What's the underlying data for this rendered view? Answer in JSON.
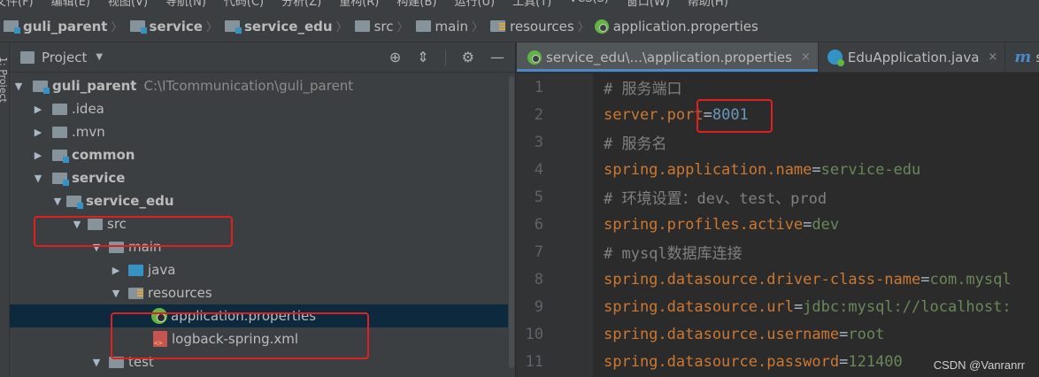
{
  "menu": [
    "文件(F)",
    "编辑(E)",
    "视图(V)",
    "导航(N)",
    "代码(C)",
    "分析(Z)",
    "重构(R)",
    "构建(B)",
    "运行(U)",
    "工具(T)",
    "VCS(S)",
    "窗口(W)",
    "帮助(H)"
  ],
  "breadcrumb": {
    "items": [
      "guli_parent",
      "service",
      "service_edu",
      "src",
      "main",
      "resources",
      "application.properties"
    ]
  },
  "left_strip": {
    "label": "1: Project"
  },
  "project_panel": {
    "title": "Project",
    "tools": {
      "locate": "⊕",
      "collapse": "⇕",
      "settings": "⚙",
      "hide": "—"
    },
    "tree": [
      {
        "label": "guli_parent",
        "path": "C:\\ITcommunication\\guli_parent"
      },
      {
        "label": ".idea"
      },
      {
        "label": ".mvn"
      },
      {
        "label": "common"
      },
      {
        "label": "service"
      },
      {
        "label": "service_edu"
      },
      {
        "label": "src"
      },
      {
        "label": "main"
      },
      {
        "label": "java"
      },
      {
        "label": "resources"
      },
      {
        "label": "application.properties"
      },
      {
        "label": "logback-spring.xml"
      },
      {
        "label": "test"
      }
    ]
  },
  "editor": {
    "tabs": [
      {
        "label": "service_edu\\...\\application.properties",
        "close": "×"
      },
      {
        "label": "EduApplication.java",
        "close": "×"
      },
      {
        "label": "se"
      }
    ],
    "lines": [
      {
        "n": "1",
        "comment": "# 服务端口"
      },
      {
        "n": "2",
        "key": "server.port",
        "eq": "=",
        "value": "8001"
      },
      {
        "n": "3",
        "comment": "# 服务名"
      },
      {
        "n": "4",
        "key": "spring.application.name",
        "eq": "=",
        "value": "service-edu"
      },
      {
        "n": "5",
        "comment": "# 环境设置：dev、test、prod"
      },
      {
        "n": "6",
        "key": "spring.profiles.active",
        "eq": "=",
        "value": "dev"
      },
      {
        "n": "7",
        "comment": "# mysql数据库连接"
      },
      {
        "n": "8",
        "key": "spring.datasource.driver-class-name",
        "eq": "=",
        "value": "com.mysql"
      },
      {
        "n": "9",
        "key": "spring.datasource.url",
        "eq": "=",
        "value": "jdbc:mysql://localhost:"
      },
      {
        "n": "10",
        "key": "spring.datasource.username",
        "eq": "=",
        "value": "root"
      },
      {
        "n": "11",
        "key": "spring.datasource.password",
        "eq": "=",
        "value": "121400"
      }
    ]
  },
  "watermark": "CSDN @Vanranrr",
  "colors": {
    "highlight_box": "#e02020",
    "selection": "#0d293e",
    "active_tab_underline": "#4a88c7"
  }
}
